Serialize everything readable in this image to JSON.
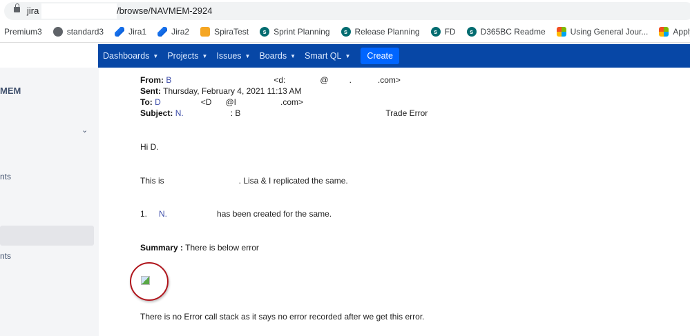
{
  "browser": {
    "url_prefix": "jira",
    "url_suffix": "/browse/NAVMEM-2924"
  },
  "bookmarks": [
    {
      "label": "Premium3",
      "icon": "none"
    },
    {
      "label": "standard3",
      "icon": "globe-icon"
    },
    {
      "label": "Jira1",
      "icon": "jira-icon"
    },
    {
      "label": "Jira2",
      "icon": "jira-icon"
    },
    {
      "label": "SpiraTest",
      "icon": "spiratest-icon"
    },
    {
      "label": "Sprint Planning",
      "icon": "sharepoint-icon"
    },
    {
      "label": "Release Planning",
      "icon": "sharepoint-icon"
    },
    {
      "label": "FD",
      "icon": "sharepoint-icon"
    },
    {
      "label": "D365BC Readme",
      "icon": "sharepoint-icon"
    },
    {
      "label": "Using General Jour...",
      "icon": "microsoft-icon"
    },
    {
      "label": "Apply Custo",
      "icon": "microsoft-icon"
    }
  ],
  "nav": {
    "items": [
      "Dashboards",
      "Projects",
      "Issues",
      "Boards",
      "Smart QL"
    ],
    "create": "Create"
  },
  "sidebar": {
    "project": "MEM",
    "item1": "nts",
    "item2": "nts"
  },
  "email": {
    "from_label": "From:",
    "from_name": "B",
    "from_addr1": "<d:",
    "from_at": "@",
    "from_dot": ".",
    "from_com": ".com>",
    "sent_label": "Sent:",
    "sent": "Thursday, February 4, 2021 11:13 AM",
    "to_label": "To:",
    "to_name": "D",
    "to_addr": "<D",
    "to_at": "@I",
    "to_com": ".com>",
    "subject_label": "Subject:",
    "subject_a": "N.",
    "subject_b": ": B",
    "subject_c": "Trade Error",
    "greeting": "Hi D.",
    "line1_a": "This is",
    "line1_b": ". Lisa & I replicated the same.",
    "list_num": "1.",
    "list_link": "N.",
    "list_text": "has been created for the same.",
    "summary_label": "Summary :",
    "summary_text": "There is below error",
    "footer": "There is no Error call stack as it says no error recorded after we get this error."
  }
}
